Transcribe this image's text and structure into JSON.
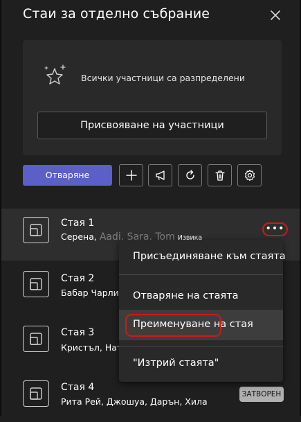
{
  "panel": {
    "title": "Стаи за отделно събрание",
    "close_icon": "close-icon"
  },
  "status_card": {
    "icon": "star-sparkle-icon",
    "message": "Всички участници са разпределени",
    "assign_button": "Присвояване на участници"
  },
  "toolbar": {
    "open_button": "Отваряне",
    "tools": [
      "add-icon",
      "announcement-icon",
      "refresh-icon",
      "delete-icon",
      "settings-icon"
    ],
    "accent_color": "#5b5fc7"
  },
  "rooms": [
    {
      "name": "Стая 1",
      "members_prefix": "Серена,",
      "members_faded": "Aadi, Sara, Tom",
      "members_tag": "Извика"
    },
    {
      "name": "Стая 2",
      "members": "Бабар Чарли"
    },
    {
      "name": "Стая 3",
      "members": "Кристъл, Нат"
    },
    {
      "name": "Стая 4",
      "members": "Рита Рей, Джошуа, Дарън, Хила",
      "badge": "ЗАТВОРЕН"
    }
  ],
  "context_menu": {
    "items": [
      "Присъединяване към стаята",
      "Отваряне на стаята",
      "Преименуване на стая",
      "\"Изтрий стаята\""
    ],
    "highlight_color": "#d01818"
  }
}
